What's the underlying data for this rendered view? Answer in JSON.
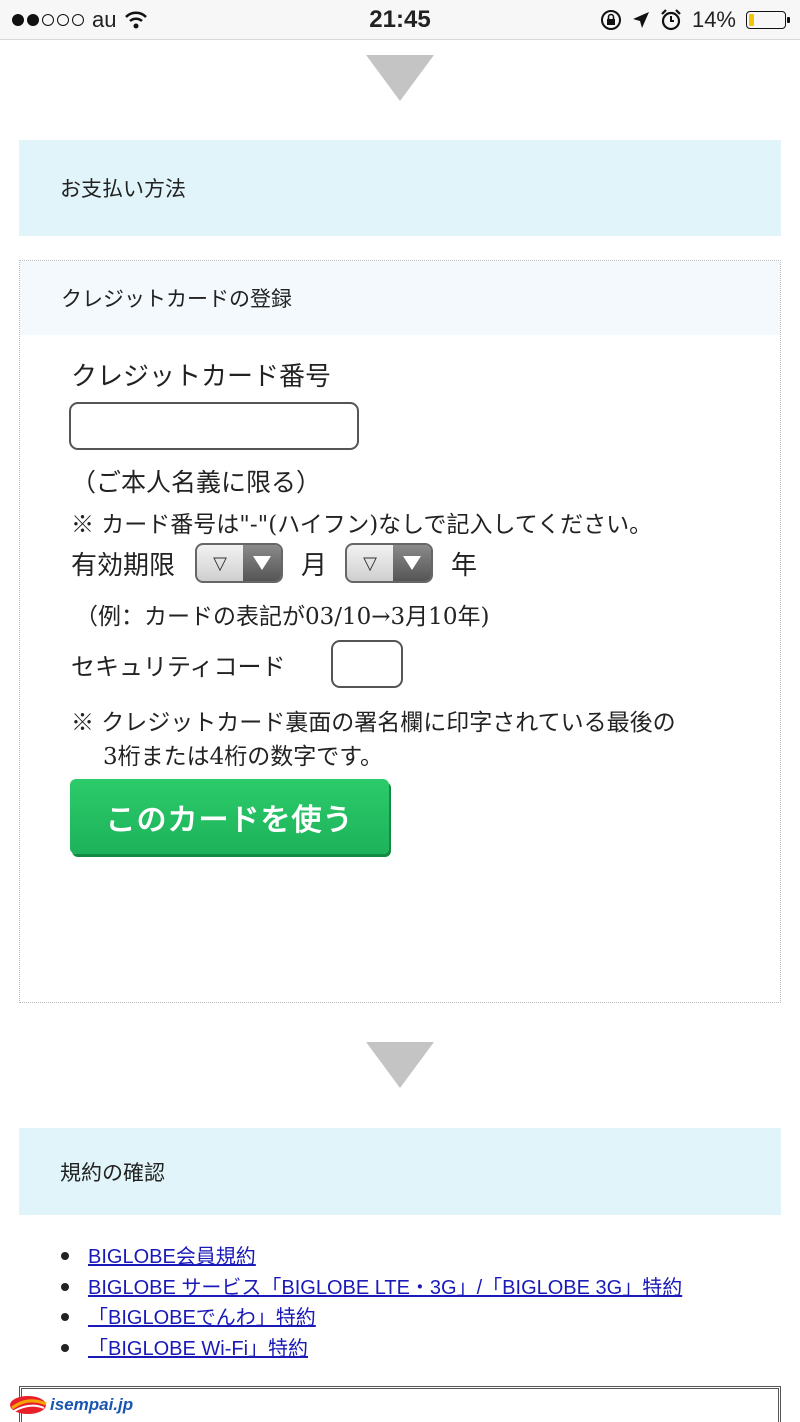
{
  "status_bar": {
    "carrier": "au",
    "time": "21:45",
    "battery_percent": "14%",
    "battery_level": 0.14,
    "icons": [
      "signal-dots",
      "wifi-icon",
      "lock-rotation-icon",
      "location-arrow-icon",
      "alarm-icon",
      "battery-icon"
    ]
  },
  "payment_section": {
    "title": "お支払い方法"
  },
  "credit_card": {
    "box_title": "クレジットカードの登録",
    "number_label": "クレジットカード番号",
    "number_value": "",
    "holder_note": "（ご本人名義に限る）",
    "hyphen_note": "※ カード番号は\"-\"(ハイフン)なしで記入してください。",
    "expiry_label": "有効期限",
    "month_select": "▽",
    "month_unit": "月",
    "year_select": "▽",
    "year_unit": "年",
    "expiry_example": "（例：カードの表記が03/10→3月10年)",
    "security_label": "セキュリティコード",
    "security_value": "",
    "security_note_1": "※ クレジットカード裏面の署名欄に印字されている最後の",
    "security_note_2": "3桁または4桁の数字です。",
    "use_button": "このカードを使う"
  },
  "terms_section": {
    "title": "規約の確認",
    "links": [
      "BIGLOBE会員規約",
      "BIGLOBE サービス「BIGLOBE LTE・3G」/「BIGLOBE 3G」特約",
      "「BIGLOBEでんわ」特約",
      "「BIGLOBE Wi-Fi」特約"
    ]
  },
  "watermark": {
    "text": "isempai.jp"
  },
  "colors": {
    "section_bg": "#e1f4f9",
    "button_green": "#1db25a",
    "link_blue": "#1a1ab8"
  }
}
